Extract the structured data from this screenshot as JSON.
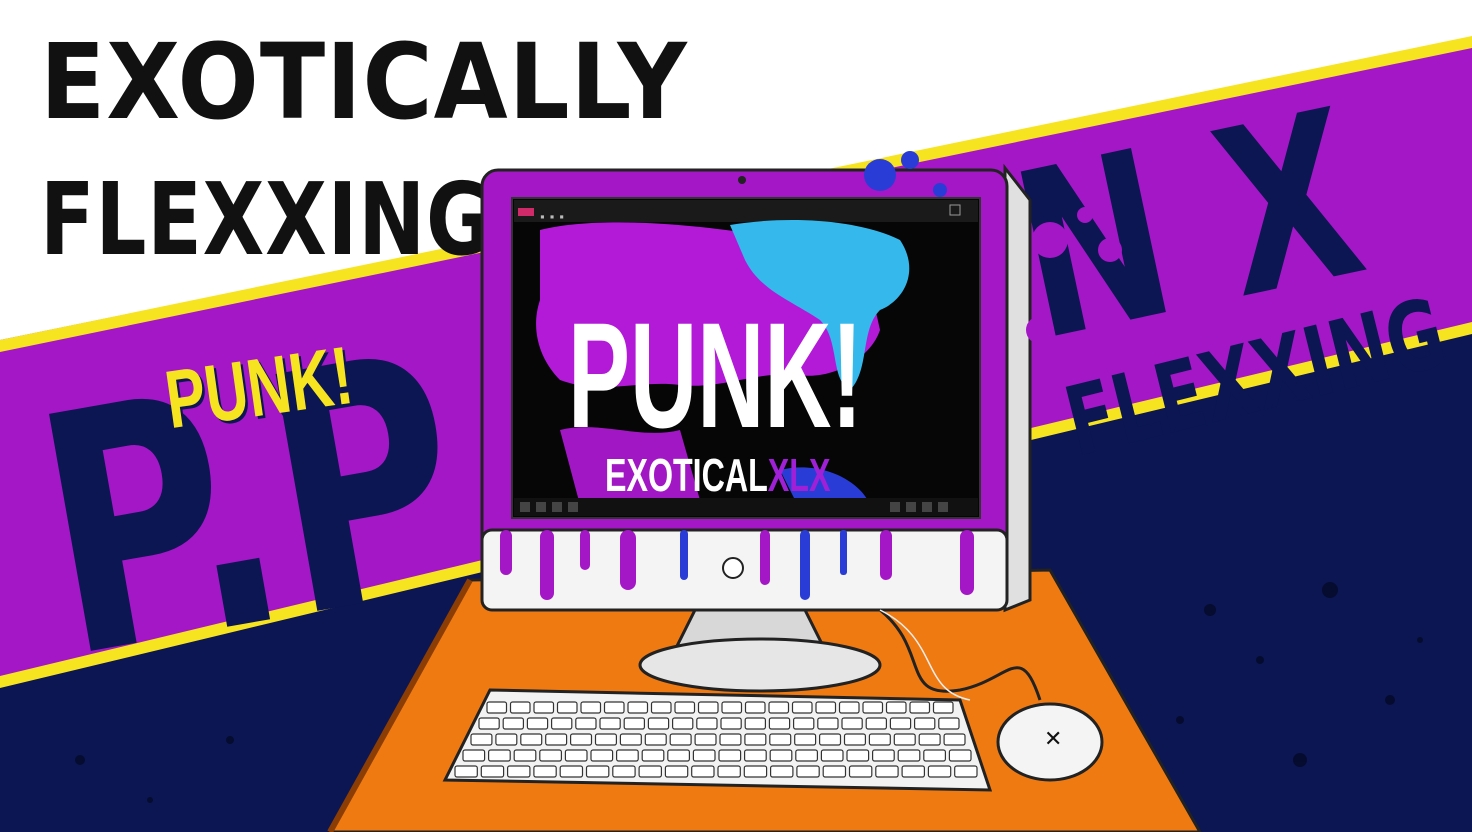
{
  "headline": {
    "line1": "EXOTICALLY",
    "line2": "FLEXXING"
  },
  "background": {
    "big_letters_left": "P.P",
    "big_letters_right": "N X",
    "punk_yellow": "PUNK!",
    "flexxing": "FLEXXING"
  },
  "monitor": {
    "screen_title": "PUNK!",
    "screen_subtitle": "EXOTICAL",
    "screen_subtitle_tail": "XLX"
  },
  "colors": {
    "purple": "#a417c6",
    "navy": "#0b1652",
    "yellow": "#f7e421",
    "orange": "#f07a12",
    "cyan": "#35b8ec"
  }
}
